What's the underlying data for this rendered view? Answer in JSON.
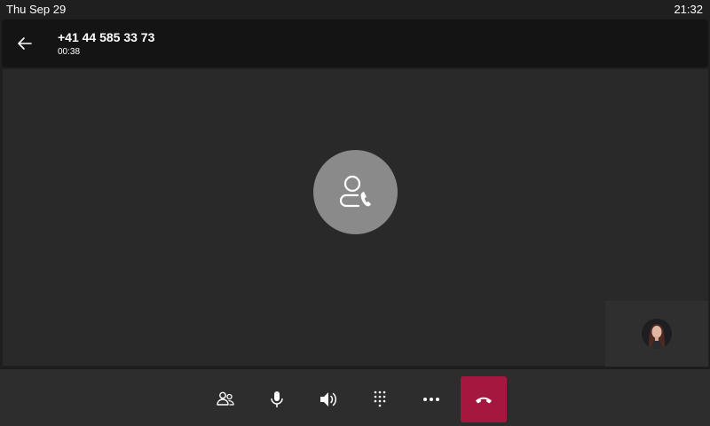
{
  "status_bar": {
    "date": "Thu Sep 29",
    "time": "21:32"
  },
  "call": {
    "number": "+41 44 585 33 73",
    "duration": "00:38"
  },
  "icons": {
    "back": "arrow-left-icon",
    "remote_avatar": "person-phone-icon",
    "participants": "people-icon",
    "mute": "microphone-icon",
    "speaker": "speaker-volume-icon",
    "dialpad": "dialpad-icon",
    "more": "more-options-icon",
    "hangup": "hang-up-phone-icon"
  },
  "colors": {
    "hangup_red": "#a4173f",
    "avatar_gray": "#8a8a8a",
    "stage_bg": "#292929"
  }
}
